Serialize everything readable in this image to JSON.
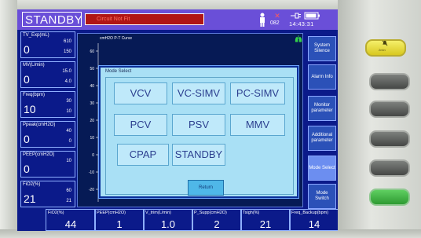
{
  "header": {
    "mode": "STANDBY",
    "alarm_message": "Circuit Not Fit",
    "alarm_count": "082",
    "time": "14:43:31"
  },
  "left_params": [
    {
      "label": "TV_Exp(mL)",
      "value": "0",
      "hi": "610",
      "lo": "150"
    },
    {
      "label": "MV(L/min)",
      "value": "0",
      "hi": "15.0",
      "lo": "4.0"
    },
    {
      "label": "Freq(bpm)",
      "value": "10",
      "hi": "30",
      "lo": "10"
    },
    {
      "label": "Ppeak(cmH2O)",
      "value": "0",
      "hi": "40",
      "lo": "0"
    },
    {
      "label": "PEEP(cmH2O)",
      "value": "0",
      "hi": "10",
      "lo": ""
    },
    {
      "label": "FiO2(%)",
      "value": "21",
      "hi": "60",
      "lo": "21"
    }
  ],
  "waveform": {
    "title": "cmH2O  P-T Curve",
    "y_ticks": [
      "60",
      "50",
      "40",
      "30",
      "20",
      "10",
      "0",
      "-10",
      "-20"
    ]
  },
  "side_buttons": [
    {
      "label": "System Silence"
    },
    {
      "label": "Alarm Info"
    },
    {
      "label": "Monitor parameter"
    },
    {
      "label": "Additional parameter"
    },
    {
      "label": "Mode Select"
    },
    {
      "label": "Mode Switch"
    }
  ],
  "bottom_params": [
    {
      "label": "FiO2(%)",
      "value": "44"
    },
    {
      "label": "PEEP(cmH2O)",
      "value": "1"
    },
    {
      "label": "V_trim(L/min)",
      "value": "1.0"
    },
    {
      "label": "P_Supp(cmH2O)",
      "value": "2"
    },
    {
      "label": "Tsigh(%)",
      "value": "21"
    },
    {
      "label": "Freq_Backup(bpm)",
      "value": "14"
    }
  ],
  "modal": {
    "title": "Mode Select",
    "modes": [
      "VCV",
      "VC-SIMV",
      "PC-SIMV",
      "PCV",
      "PSV",
      "MMV",
      "CPAP",
      "STANDBY"
    ],
    "return_label": "Return"
  },
  "hardware": {
    "silence_label": "2min"
  },
  "colors": {
    "screen": "#0b1a8a",
    "header": "#6a4fd8",
    "alarm": "#b01515",
    "modal": "#a9e0f5"
  }
}
